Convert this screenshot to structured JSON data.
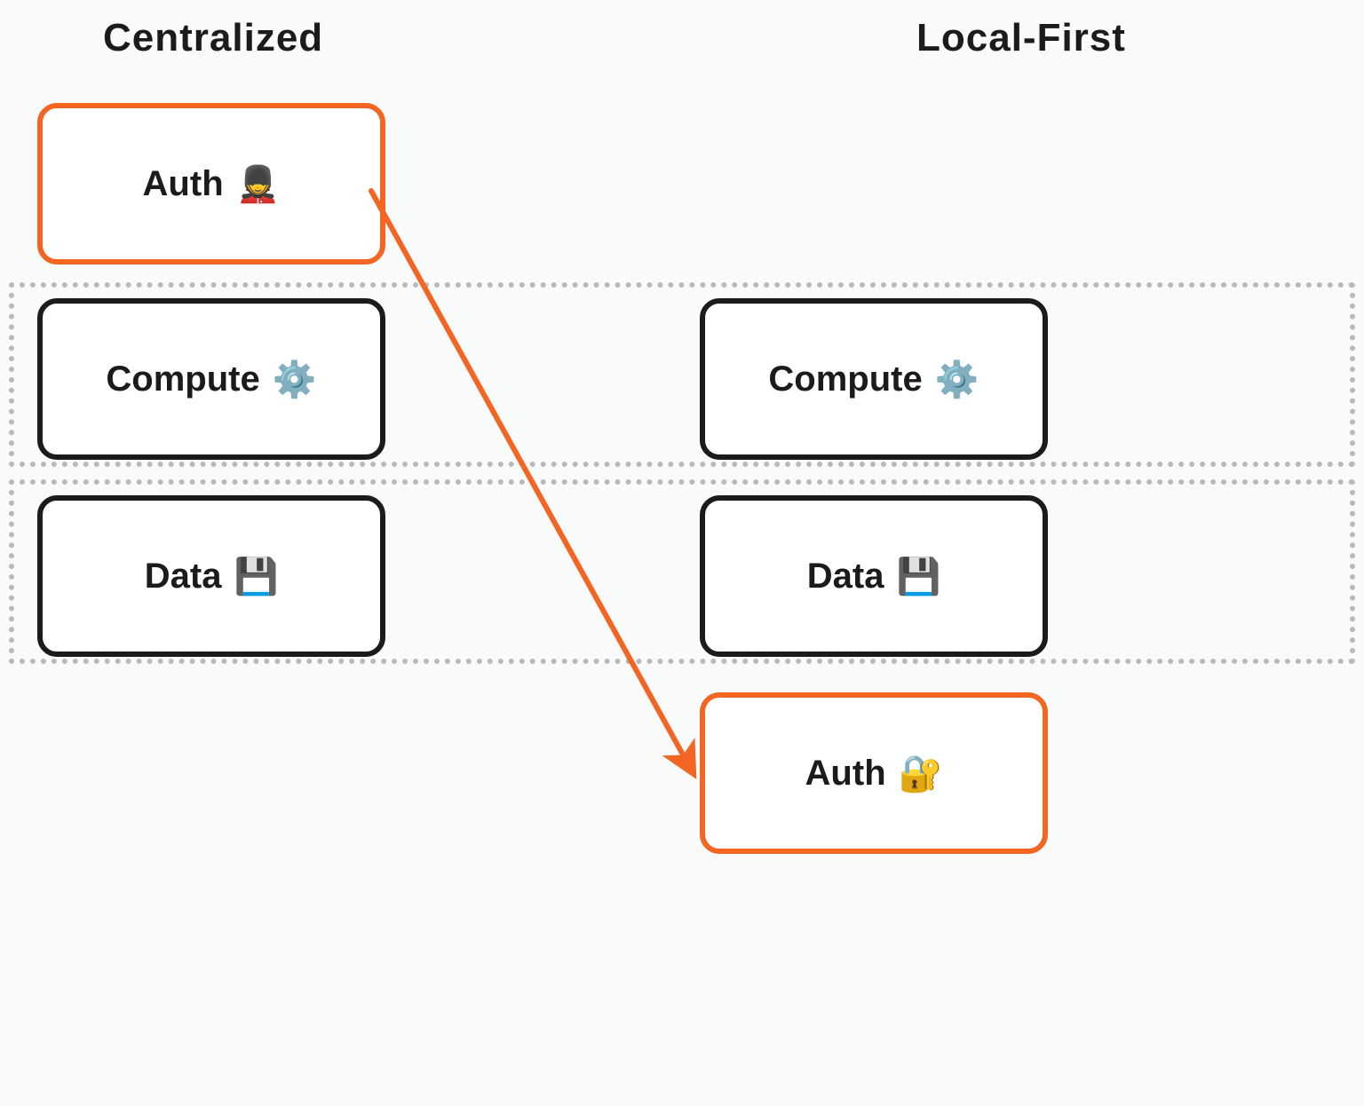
{
  "columns": {
    "left_title": "Centralized",
    "right_title": "Local-First"
  },
  "boxes": {
    "left_auth": {
      "label": "Auth",
      "emoji": "💂"
    },
    "left_compute": {
      "label": "Compute",
      "emoji": "⚙️"
    },
    "left_data": {
      "label": "Data",
      "emoji": "💾"
    },
    "right_compute": {
      "label": "Compute",
      "emoji": "⚙️"
    },
    "right_data": {
      "label": "Data",
      "emoji": "💾"
    },
    "right_auth": {
      "label": "Auth",
      "emoji": "🔐"
    }
  },
  "colors": {
    "accent": "#f26522",
    "box_border": "#1b1b1b",
    "dotted": "#b9b9b9"
  }
}
